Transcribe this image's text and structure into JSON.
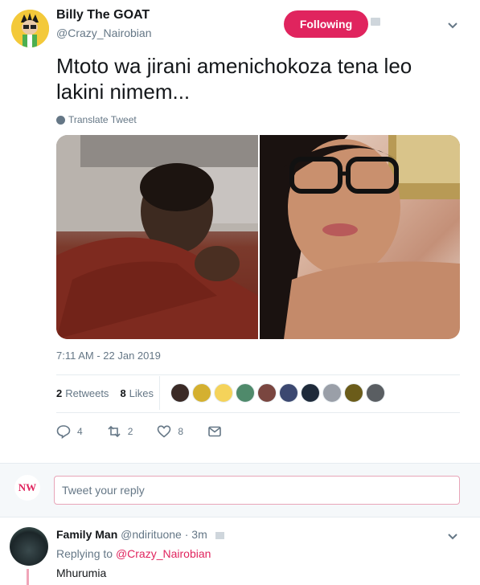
{
  "tweet": {
    "display_name": "Billy The GOAT",
    "handle": "@Crazy_Nairobian",
    "follow_label": "Following",
    "text": "Mtoto wa jirani amenichokoza tena leo lakini nimem...",
    "translate_label": "Translate Tweet",
    "timestamp": "7:11 AM - 22 Jan 2019",
    "stats": {
      "retweets_count": "2",
      "retweets_label": "Retweets",
      "likes_count": "8",
      "likes_label": "Likes"
    },
    "actions": {
      "reply_count": "4",
      "retweet_count": "2",
      "like_count": "8"
    },
    "accent_color": "#e0245e"
  },
  "compose": {
    "avatar_text": "NW",
    "placeholder": "Tweet your reply"
  },
  "reply": {
    "display_name": "Family Man",
    "handle": "@ndirituone",
    "time": "· 3m",
    "replying_prefix": "Replying to",
    "replying_handle": "@Crazy_Nairobian",
    "text": "Mhurumia"
  },
  "icons": [
    "caret-down-icon",
    "globe-icon",
    "reply-icon",
    "retweet-icon",
    "heart-icon",
    "message-icon"
  ]
}
